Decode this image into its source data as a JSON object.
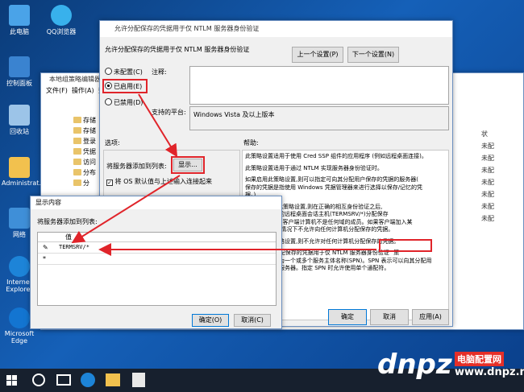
{
  "desktop": {
    "icons": [
      {
        "label": "此电脑"
      },
      {
        "label": "QQ浏览器"
      },
      {
        "label": "控制面板"
      },
      {
        "label": "回收站"
      },
      {
        "label": "Administrat..."
      },
      {
        "label": "网络"
      },
      {
        "label": "Internet Explorer"
      },
      {
        "label": "Microsoft Edge"
      }
    ]
  },
  "gpedit": {
    "title": "本地组策略编辑器",
    "menu": [
      "文件(F)",
      "操作(A)",
      "查"
    ],
    "tree": [
      "存储",
      "存储",
      "登录",
      "凭据",
      "访问",
      "分布",
      "分"
    ],
    "right_items": [
      "状",
      "未配",
      "未配",
      "未配",
      "未配",
      "未配",
      "未配",
      "未配"
    ]
  },
  "policy": {
    "title": "允许分配保存的凭据用于仅 NTLM 服务器身份验证",
    "heading": "允许分配保存的凭据用于仅 NTLM 服务器身份验证",
    "prev_button": "上一个设置(P)",
    "next_button": "下一个设置(N)",
    "radio_not_configured": "未配置(C)",
    "radio_enabled": "已启用(E)",
    "radio_disabled": "已禁用(D)",
    "comment_label": "注释:",
    "platform_label": "支持的平台:",
    "platform_value": "Windows Vista 及以上版本",
    "options_label": "选项:",
    "help_label": "帮助:",
    "add_servers_label": "将服务器添加到列表:",
    "show_button": "显示...",
    "concat_checkbox": "将 OS 默认值与上述输入连接起来",
    "help_text": [
      "此策略设置适用于使用 Cred SSP 组件的应用程序 (例如远程桌面连接)。",
      "",
      "此策略设置适用于通过 NTLM 实现服务器身份验证时。",
      "",
      "如果启用此策略设置,则可以指定可向其分配用户保存的凭据的服务器(",
      "保存的凭据是指使用 Windows 凭据管理器来进行选择以保存/记忆的凭",
      "据。)",
      "",
      "默认情况下) 此策略设置,则在正确的相互身份验证之后,",
      "分配计算机上的远程桌面会话主机(TERMSRV/*)分配保存",
      "的凭据,服务器,客户端计算机不是任何域的成员。如果客户端加入某",
      "个域,则在默认情况下不允许向任何计算机分配保存的凭据。",
      "",
      "如果禁用此策略设置,则不允许对任何计算机分配保存的凭据。",
      "",
      "注意: \"允许分配保存的凭据用于仅 NTLM 服务器身份验证\" 策",
      "略设置可设置为一个或多个服务主体名称(SPN)。SPN 表示可以向其分配用",
      "户凭据的目标服务器。指定 SPN 时允许使用单个通配符。"
    ],
    "ok_button": "确定",
    "cancel_button": "取消",
    "apply_button": "应用(A)"
  },
  "show_dialog": {
    "title": "显示内容",
    "label": "将服务器添加到列表:",
    "column_header": "值",
    "rows": [
      {
        "marker": "✎",
        "value": "TERMSRV/*"
      },
      {
        "marker": "*",
        "value": ""
      }
    ],
    "ok_button": "确定(O)",
    "cancel_button": "取消(C)"
  },
  "watermark": {
    "brand": "dnpz",
    "text": "电脑配置网",
    "domain": "www.dnpz.net"
  },
  "colors": {
    "annotation_red": "#e0242a",
    "accent": "#0078d7"
  }
}
